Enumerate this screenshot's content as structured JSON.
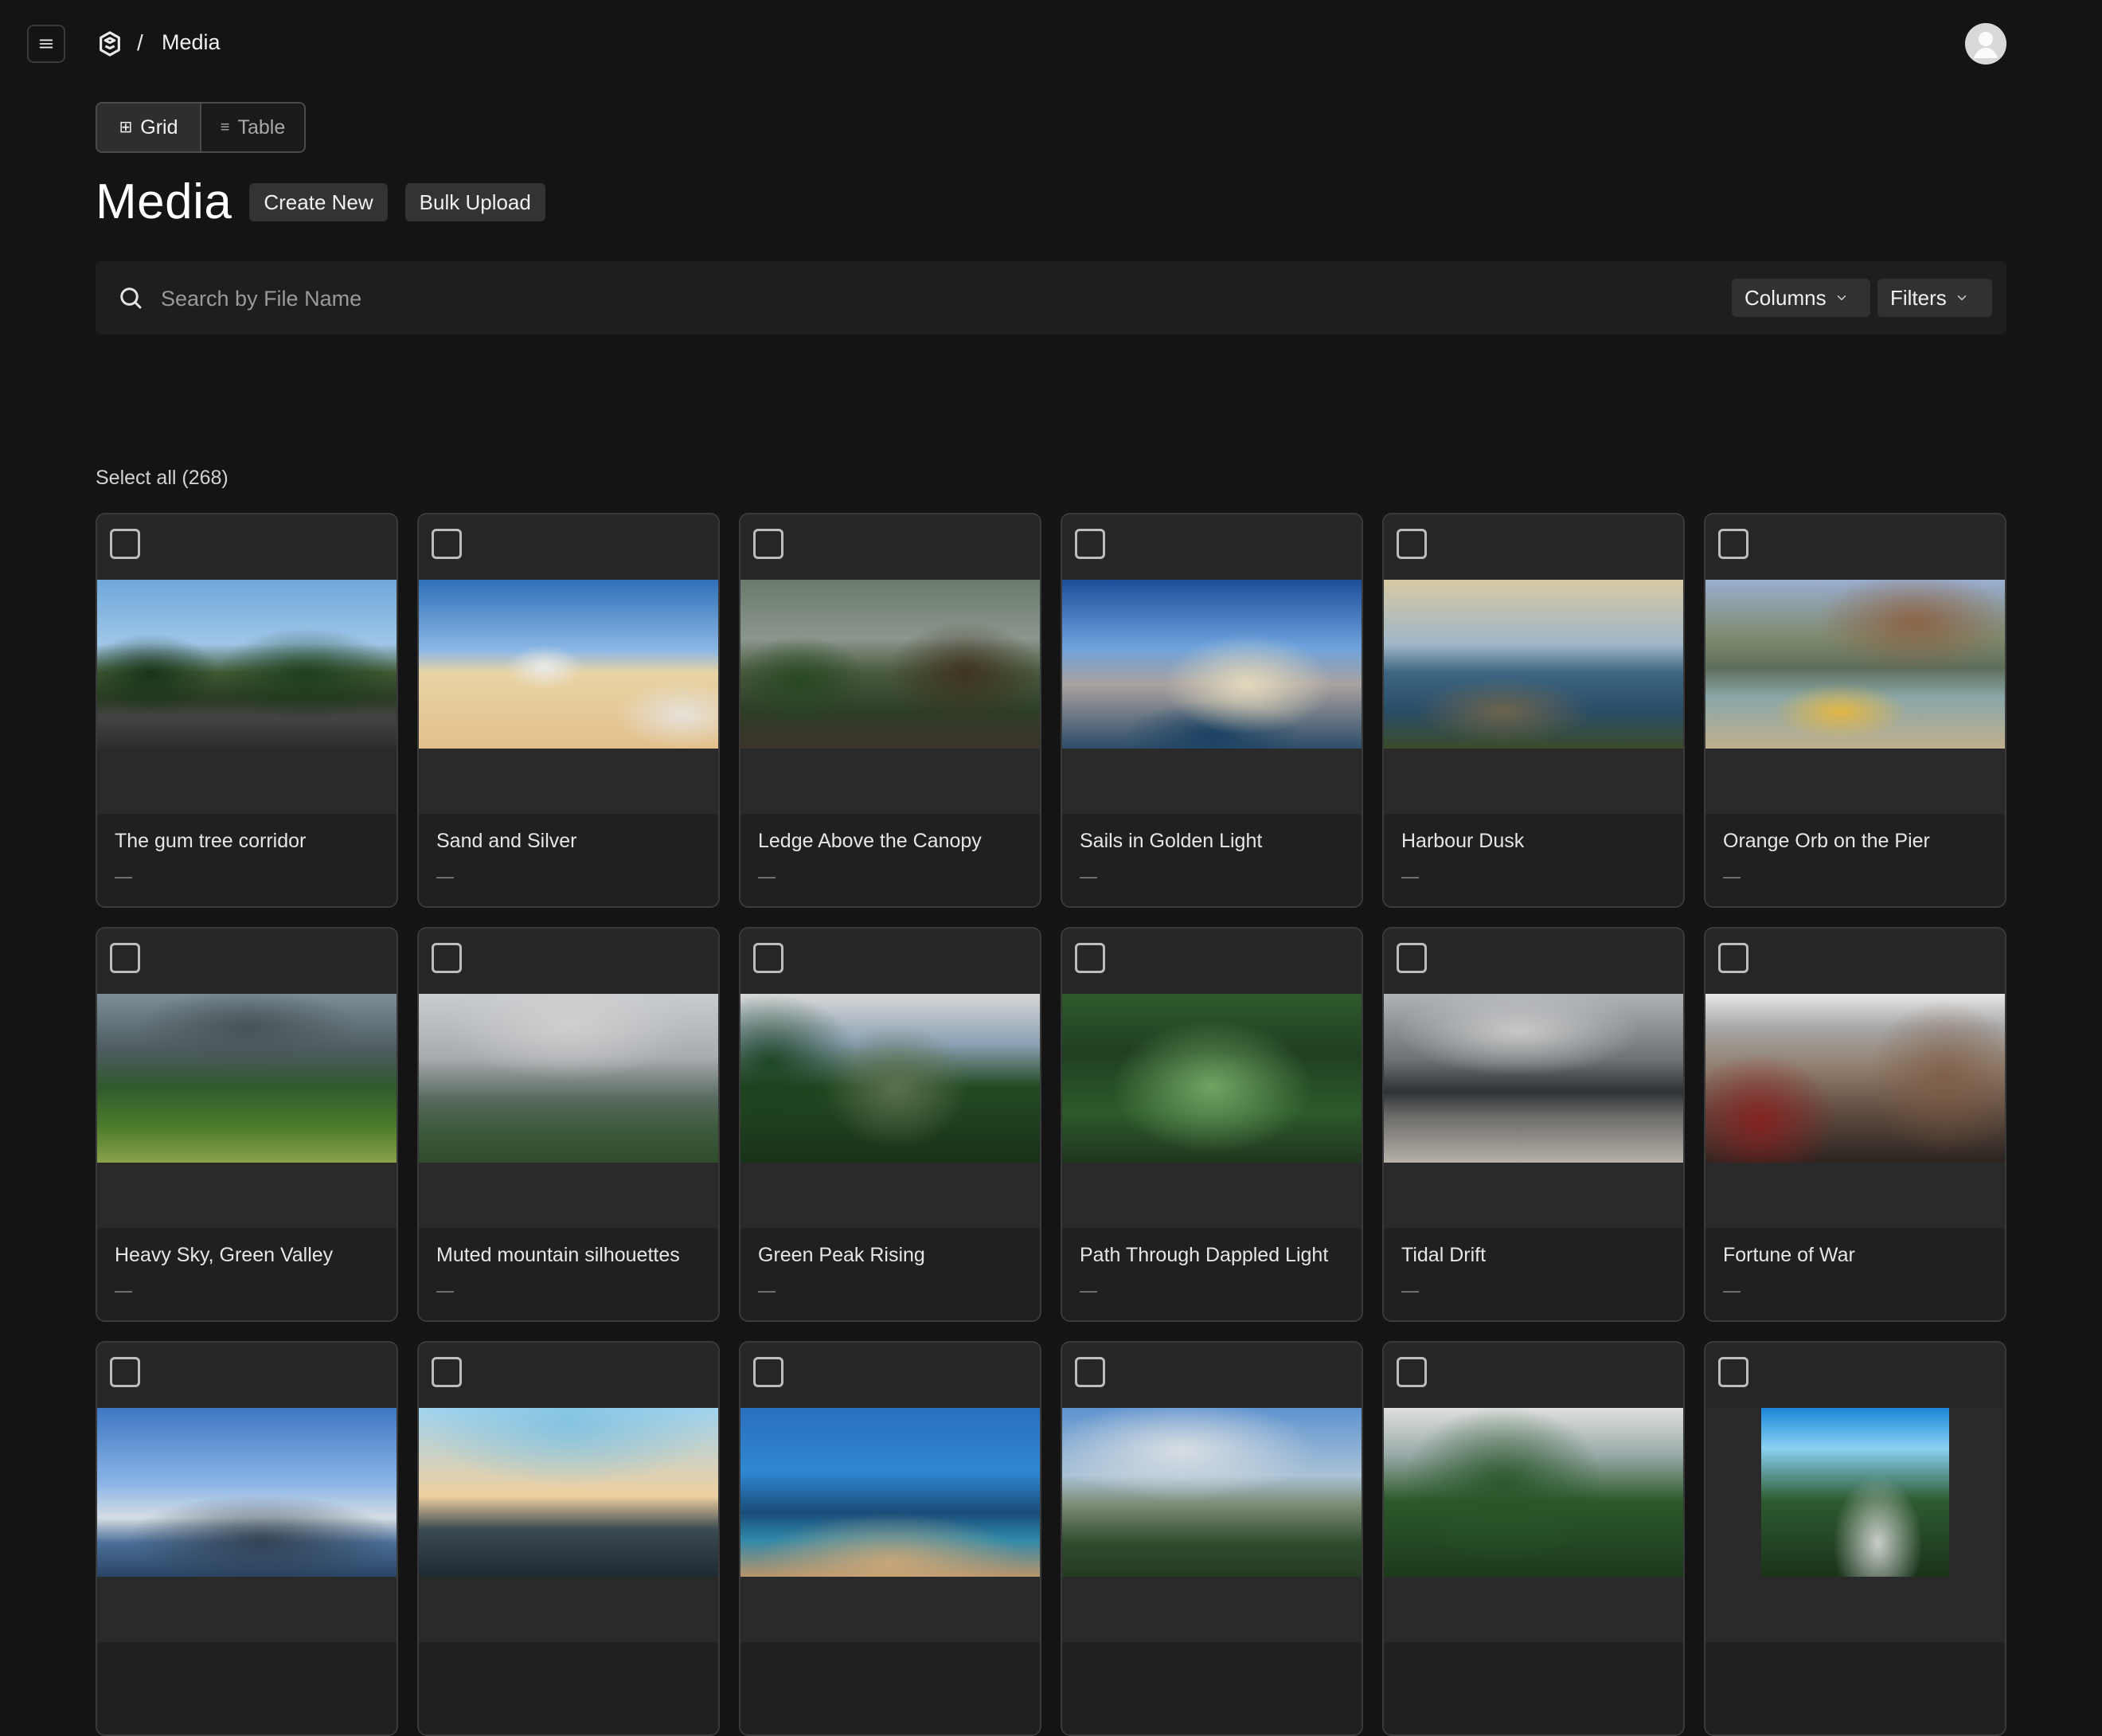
{
  "topbar": {
    "breadcrumb_sep": "/",
    "breadcrumb": "Media"
  },
  "view_toggle": {
    "grid_label": "Grid",
    "table_label": "Table",
    "grid_icon": "grid-icon",
    "table_icon": "list-icon"
  },
  "header": {
    "title": "Media",
    "create_new": "Create New",
    "bulk_upload": "Bulk Upload"
  },
  "search": {
    "placeholder": "Search by File Name",
    "value": "",
    "columns_label": "Columns",
    "filters_label": "Filters"
  },
  "selection": {
    "select_all": "Select all (268)"
  },
  "items": [
    {
      "name": "The gum tree corridor",
      "meta": "—"
    },
    {
      "name": "Sand and Silver",
      "meta": "—"
    },
    {
      "name": "Ledge Above the Canopy",
      "meta": "—"
    },
    {
      "name": "Sails in Golden Light",
      "meta": "—"
    },
    {
      "name": "Harbour Dusk",
      "meta": "—"
    },
    {
      "name": "Orange Orb on the Pier",
      "meta": "—"
    },
    {
      "name": "Heavy Sky, Green Valley",
      "meta": "—"
    },
    {
      "name": "Muted mountain silhouettes",
      "meta": "—"
    },
    {
      "name": "Green Peak Rising",
      "meta": "—"
    },
    {
      "name": "Path Through Dappled Light",
      "meta": "—"
    },
    {
      "name": "Tidal Drift",
      "meta": "—"
    },
    {
      "name": "Fortune of War",
      "meta": "—"
    },
    {
      "name": "",
      "meta": ""
    },
    {
      "name": "",
      "meta": ""
    },
    {
      "name": "",
      "meta": ""
    },
    {
      "name": "",
      "meta": ""
    },
    {
      "name": "",
      "meta": ""
    },
    {
      "name": "",
      "meta": ""
    }
  ]
}
